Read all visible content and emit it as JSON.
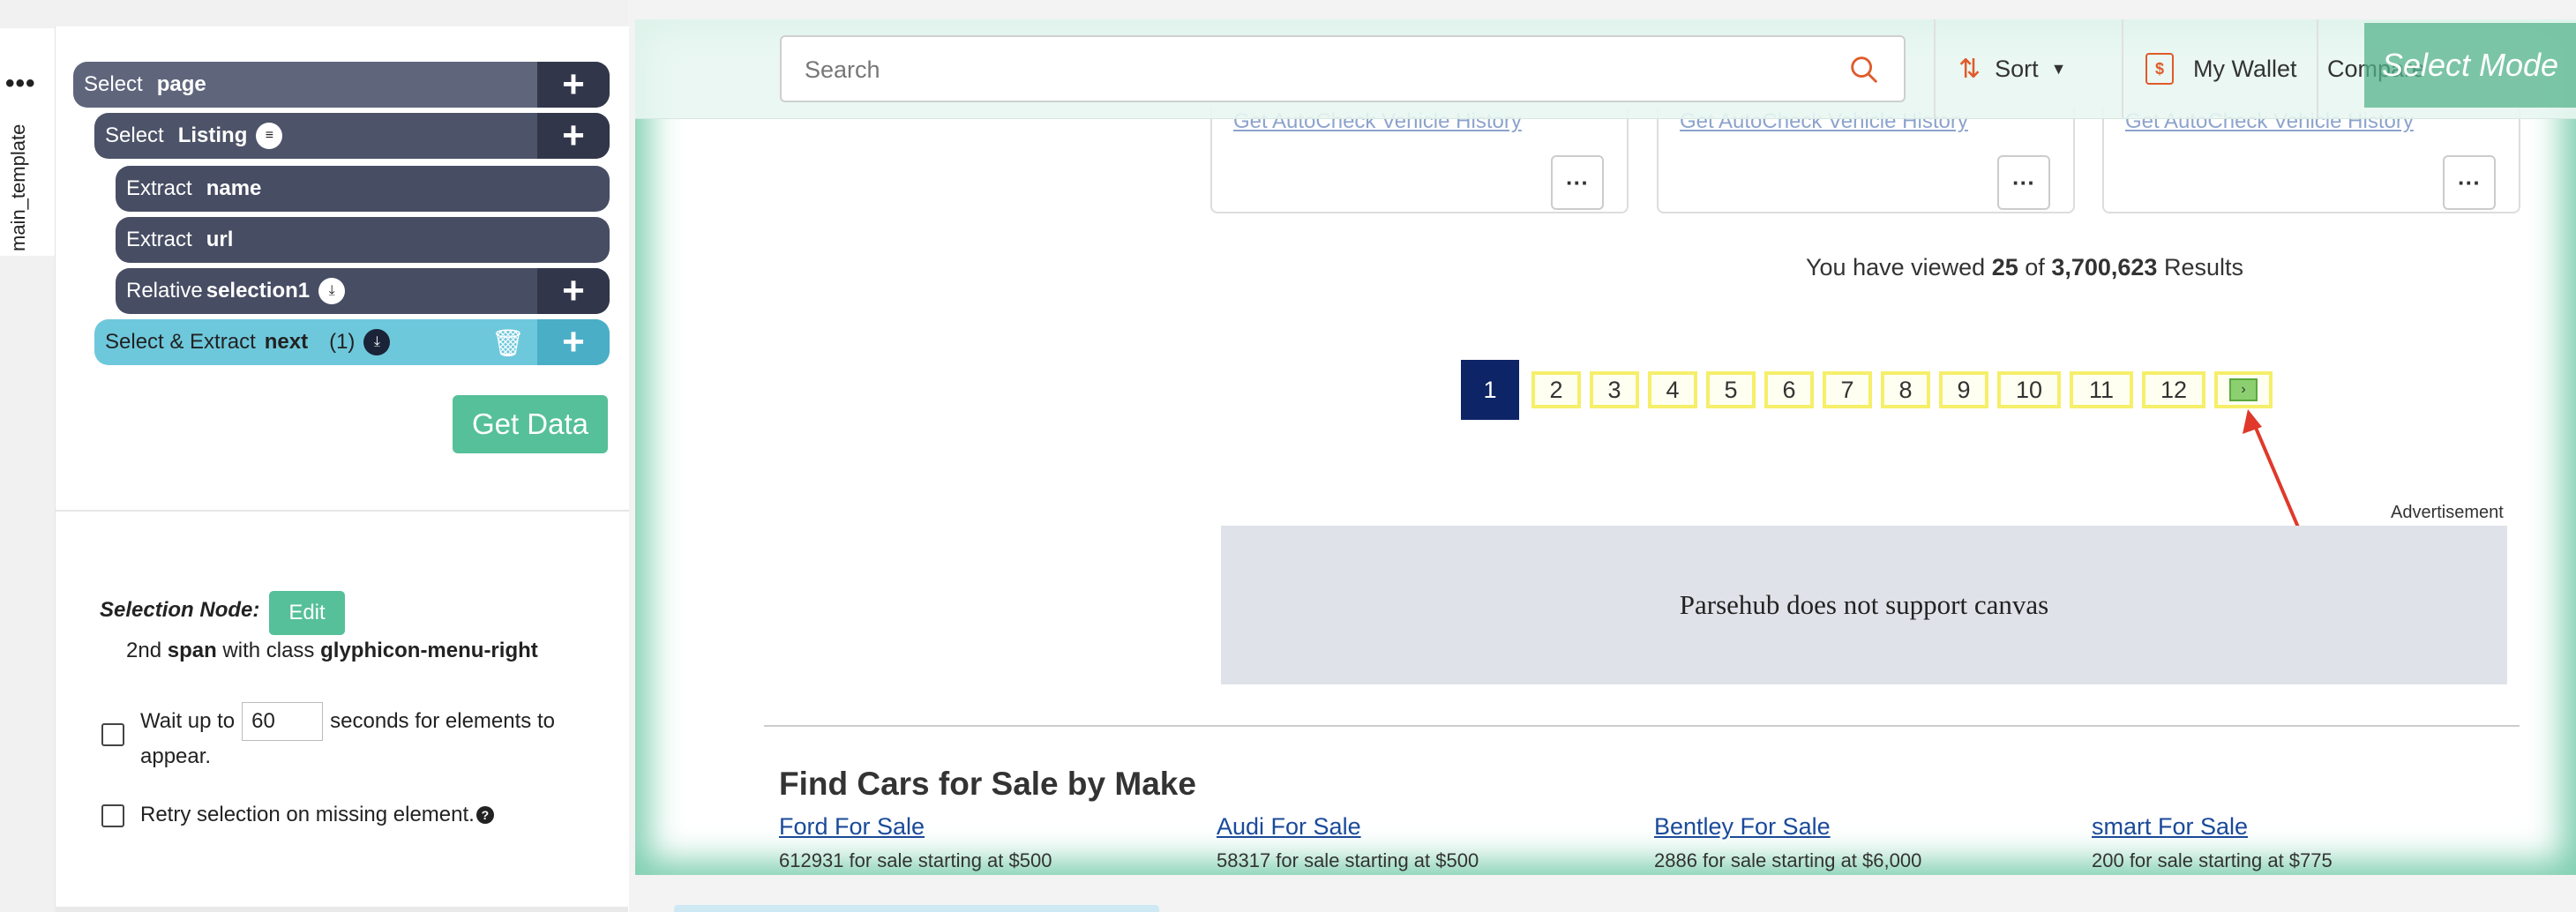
{
  "sidebar_tab": {
    "label": "main_template",
    "menu": "•••"
  },
  "commands": [
    {
      "verb": "Select",
      "arg": "page",
      "plus": "+"
    },
    {
      "verb": "Select",
      "arg": "Listing",
      "plus": "+"
    },
    {
      "verb": "Extract",
      "arg": "name"
    },
    {
      "verb": "Extract",
      "arg": "url"
    },
    {
      "verb": "Relative",
      "arg": "selection1",
      "plus": "+"
    },
    {
      "verb": "Select & Extract",
      "arg": "next",
      "count": "(1)",
      "plus": "+"
    }
  ],
  "get_data_label": "Get Data",
  "selection_node": {
    "label": "Selection Node:",
    "edit_label": "Edit",
    "desc_pre": "2nd",
    "desc_tag": "span",
    "desc_mid": "with class",
    "desc_class": "glyphicon-menu-right"
  },
  "wait": {
    "pre": "Wait up to",
    "value": "60",
    "post": "seconds for elements to",
    "post2": "appear."
  },
  "retry_label": "Retry selection on missing element.",
  "browser": {
    "search_placeholder": "Search",
    "sort_label": "Sort",
    "wallet_label": "My Wallet",
    "compare_label": "Compare",
    "select_mode": "Select Mode",
    "card_link": "Get AutoCheck Vehicle History",
    "more_label": "···",
    "results": {
      "pre": "You have viewed",
      "viewed": "25",
      "mid": "of",
      "total": "3,700,623",
      "post": "Results"
    },
    "pages": [
      "1",
      "2",
      "3",
      "4",
      "5",
      "6",
      "7",
      "8",
      "9",
      "10",
      "11",
      "12"
    ],
    "next_glyph": "›",
    "ad_label": "Advertisement",
    "ad_text": "Parsehub does not support canvas",
    "makes_title": "Find Cars for Sale by Make",
    "makes": [
      {
        "name": "Ford For Sale",
        "sub": "612931 for sale starting at $500"
      },
      {
        "name": "Audi For Sale",
        "sub": "58317 for sale starting at $500"
      },
      {
        "name": "Bentley For Sale",
        "sub": "2886 for sale starting at $6,000"
      },
      {
        "name": "smart For Sale",
        "sub": "200 for sale starting at $775"
      }
    ]
  },
  "colors": {
    "accent_green": "#55c09a",
    "active_command": "#6ec8dc",
    "page_current": "#0d2466",
    "highlight_yellow": "#f5ef6a",
    "arrow_red": "#e0392b"
  }
}
